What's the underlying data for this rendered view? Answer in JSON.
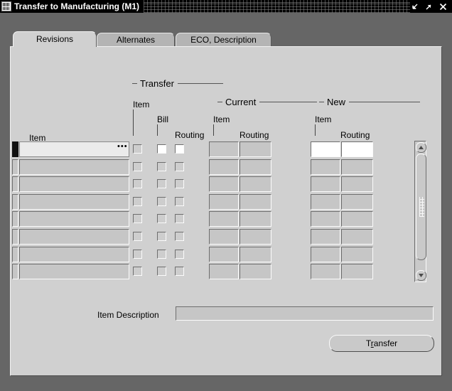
{
  "window": {
    "title": "Transfer to Manufacturing (M1)",
    "app_icon": "forms-app-icon",
    "buttons": {
      "minimize": "minimize-icon",
      "maximize": "maximize-icon",
      "close": "close-icon"
    }
  },
  "tabs": [
    {
      "label": "Revisions",
      "active": true
    },
    {
      "label": "Alternates",
      "active": false
    },
    {
      "label": "ECO, Description",
      "active": false
    }
  ],
  "groups": {
    "transfer": "Transfer",
    "current": "Current",
    "new": "New"
  },
  "captions": {
    "item_column": "Item",
    "transfer_item": "Item",
    "transfer_bill": "Bill",
    "transfer_routing": "Routing",
    "current_item": "Item",
    "current_routing": "Routing",
    "new_item": "Item",
    "new_routing": "Routing"
  },
  "grid": {
    "row_count": 8,
    "rows": [
      {
        "record_current": true,
        "item": "",
        "transfer_item_checked": false,
        "transfer_item_enabled": false,
        "transfer_bill_checked": false,
        "transfer_bill_enabled": true,
        "transfer_routing_checked": false,
        "transfer_routing_enabled": true,
        "current_item": "",
        "current_routing": "",
        "new_item": "",
        "new_routing": "",
        "new_enabled": true
      },
      {
        "record_current": false,
        "item": "",
        "transfer_item_enabled": false,
        "transfer_bill_enabled": false,
        "transfer_routing_enabled": false,
        "current_item": "",
        "current_routing": "",
        "new_item": "",
        "new_routing": "",
        "new_enabled": false
      },
      {
        "record_current": false,
        "item": "",
        "transfer_item_enabled": false,
        "transfer_bill_enabled": false,
        "transfer_routing_enabled": false,
        "current_item": "",
        "current_routing": "",
        "new_item": "",
        "new_routing": "",
        "new_enabled": false
      },
      {
        "record_current": false,
        "item": "",
        "transfer_item_enabled": false,
        "transfer_bill_enabled": false,
        "transfer_routing_enabled": false,
        "current_item": "",
        "current_routing": "",
        "new_item": "",
        "new_routing": "",
        "new_enabled": false
      },
      {
        "record_current": false,
        "item": "",
        "transfer_item_enabled": false,
        "transfer_bill_enabled": false,
        "transfer_routing_enabled": false,
        "current_item": "",
        "current_routing": "",
        "new_item": "",
        "new_routing": "",
        "new_enabled": false
      },
      {
        "record_current": false,
        "item": "",
        "transfer_item_enabled": false,
        "transfer_bill_enabled": false,
        "transfer_routing_enabled": false,
        "current_item": "",
        "current_routing": "",
        "new_item": "",
        "new_routing": "",
        "new_enabled": false
      },
      {
        "record_current": false,
        "item": "",
        "transfer_item_enabled": false,
        "transfer_bill_enabled": false,
        "transfer_routing_enabled": false,
        "current_item": "",
        "current_routing": "",
        "new_item": "",
        "new_routing": "",
        "new_enabled": false
      },
      {
        "record_current": false,
        "item": "",
        "transfer_item_enabled": false,
        "transfer_bill_enabled": false,
        "transfer_routing_enabled": false,
        "current_item": "",
        "current_routing": "",
        "new_item": "",
        "new_routing": "",
        "new_enabled": false
      }
    ],
    "lov_button_label": "•••"
  },
  "scrollbar": {
    "up_arrow": "scroll-up-icon",
    "down_arrow": "scroll-down-icon",
    "thumb_position_percent": 0
  },
  "description": {
    "label": "Item Description",
    "value": ""
  },
  "transfer_button": {
    "label_before": "T",
    "label_mnemonic": "r",
    "label_after": "ansfer"
  },
  "colors": {
    "frame": "#666666",
    "canvas": "#d0d0d0",
    "titlebar": "#000000",
    "field_readonly": "#c6c6c6",
    "field_editable": "#ffffff",
    "tab_active": "#d0d0d0",
    "tab_inactive": "#b4b4b4"
  }
}
